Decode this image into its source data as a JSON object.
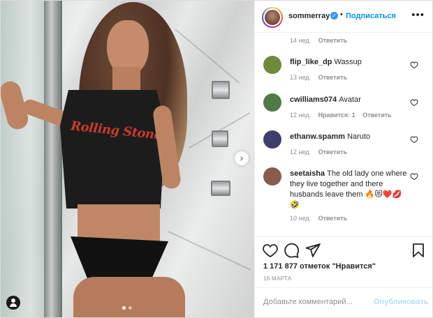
{
  "header": {
    "username": "sommerray",
    "separator": "•",
    "follow_label": "Подписаться",
    "more_icon": "more-horizontal-icon"
  },
  "photo": {
    "logo_text": "Rolling Stone",
    "carousel_total": 2,
    "carousel_active": 1
  },
  "top_meta": {
    "time": "14 нед.",
    "reply": "Ответить"
  },
  "comments": [
    {
      "username": "flip_like_dp",
      "text": "Wassup",
      "time": "13 нед.",
      "likes": "",
      "reply": "Ответить",
      "avatar_color": "#6f8a3b"
    },
    {
      "username": "cwilliams074",
      "text": "Avatar",
      "time": "12 нед.",
      "likes": "Нравится: 1",
      "reply": "Ответить",
      "avatar_color": "#4f7a45"
    },
    {
      "username": "ethanw.spamm",
      "text": "Naruto",
      "time": "12 нед.",
      "likes": "",
      "reply": "Ответить",
      "avatar_color": "#3e3f6b"
    },
    {
      "username": "seetaisha",
      "text": "The old lady one where they live together and there husbands leave them 🔥😻❤️💋🤣",
      "time": "10 нед.",
      "likes": "",
      "reply": "Ответить",
      "avatar_color": "#8a5a4a"
    }
  ],
  "likes_text": "1 171 877 отметок \"Нравится\"",
  "date_text": "16 МАРТА",
  "add_comment": {
    "placeholder": "Добавьте комментарий...",
    "publish_label": "Опубликовать"
  },
  "colors": {
    "accent": "#0095f6",
    "publish_disabled": "#b2dffc",
    "muted": "#8e8e8e",
    "verified": "#3897f0"
  }
}
